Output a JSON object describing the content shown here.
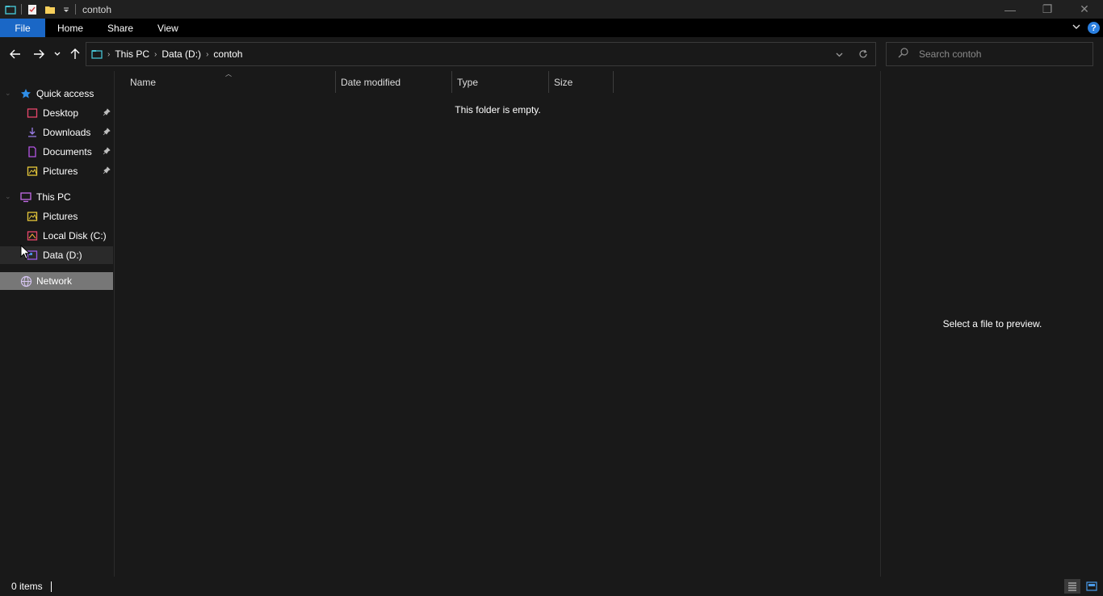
{
  "window": {
    "title": "contoh",
    "minimize_glyph": "—",
    "restore_glyph": "❐",
    "close_glyph": "✕"
  },
  "ribbon": {
    "tabs": [
      "File",
      "Home",
      "Share",
      "View"
    ],
    "help_glyph": "?"
  },
  "address": {
    "crumbs": [
      "This PC",
      "Data (D:)",
      "contoh"
    ],
    "separator": "›"
  },
  "search": {
    "placeholder": "Search contoh"
  },
  "nav": {
    "quick_access": "Quick access",
    "quick_items": [
      "Desktop",
      "Downloads",
      "Documents",
      "Pictures"
    ],
    "this_pc": "This PC",
    "pc_items": [
      "Pictures",
      "Local Disk (C:)",
      "Data (D:)"
    ],
    "network": "Network"
  },
  "columns": [
    "Name",
    "Date modified",
    "Type",
    "Size"
  ],
  "content": {
    "empty_message": "This folder is empty."
  },
  "preview": {
    "message": "Select a file to preview."
  },
  "status": {
    "items": "0 items"
  },
  "colors": {
    "accent": "#1a67c6",
    "selected_nav": "#777777",
    "background": "#191919",
    "folder_yellow": "#f7cf5b"
  }
}
